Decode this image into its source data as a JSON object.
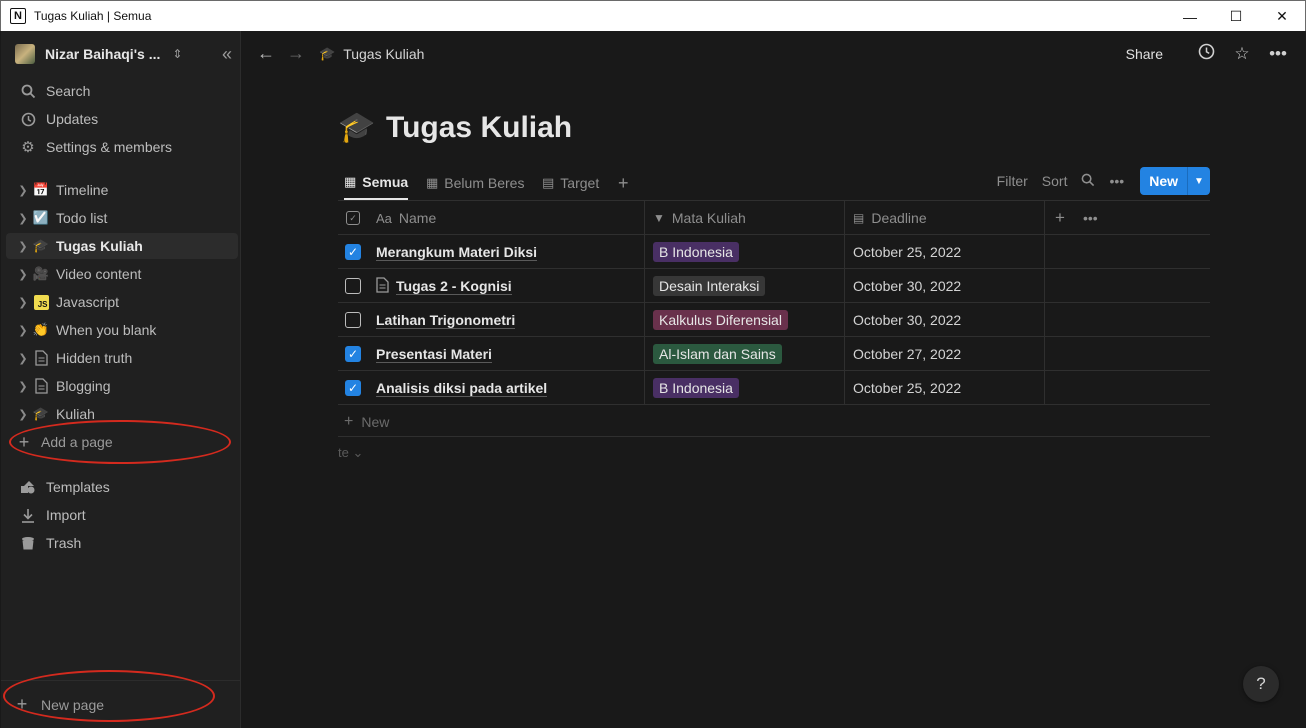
{
  "window": {
    "title": "Tugas Kuliah | Semua",
    "app_icon": "N"
  },
  "sidebar": {
    "workspace": "Nizar Baihaqi's ...",
    "nav": [
      {
        "label": "Search",
        "icon": "search-icon"
      },
      {
        "label": "Updates",
        "icon": "clock-icon"
      },
      {
        "label": "Settings & members",
        "icon": "gear-icon"
      }
    ],
    "pages": [
      {
        "label": "Timeline",
        "emoji": "📅"
      },
      {
        "label": "Todo list",
        "emoji": "☑️"
      },
      {
        "label": "Tugas Kuliah",
        "emoji": "🎓"
      },
      {
        "label": "Video content",
        "emoji": "🎥"
      },
      {
        "label": "Javascript",
        "emoji": "JS"
      },
      {
        "label": "When you blank",
        "emoji": "👏"
      },
      {
        "label": "Hidden truth",
        "emoji": "📄"
      },
      {
        "label": "Blogging",
        "emoji": "📄"
      },
      {
        "label": "Kuliah",
        "emoji": "🎓"
      }
    ],
    "add_page": "Add a page",
    "footer_nav": [
      {
        "label": "Templates",
        "icon": "shapes-icon"
      },
      {
        "label": "Import",
        "icon": "download-icon"
      },
      {
        "label": "Trash",
        "icon": "trash-icon"
      }
    ],
    "new_page": "New page"
  },
  "topbar": {
    "breadcrumb": "Tugas Kuliah",
    "share": "Share"
  },
  "page": {
    "emoji": "🎓",
    "title": "Tugas Kuliah",
    "views": [
      {
        "label": "Semua"
      },
      {
        "label": "Belum Beres"
      },
      {
        "label": "Target"
      }
    ],
    "tools": {
      "filter": "Filter",
      "sort": "Sort",
      "new": "New"
    },
    "columns": {
      "name": "Name",
      "mata_kuliah": "Mata Kuliah",
      "deadline": "Deadline",
      "name_prefix": "Aa"
    },
    "rows": [
      {
        "done": true,
        "name": "Merangkum Materi Diksi",
        "mata_kuliah": "B Indonesia",
        "deadline": "October 25, 2022",
        "has_doc": false
      },
      {
        "done": false,
        "name": "Tugas 2 - Kognisi",
        "mata_kuliah": "Desain Interaksi",
        "deadline": "October 30, 2022",
        "has_doc": true
      },
      {
        "done": false,
        "name": "Latihan Trigonometri",
        "mata_kuliah": "Kalkulus Diferensial",
        "deadline": "October 30, 2022",
        "has_doc": false
      },
      {
        "done": true,
        "name": "Presentasi Materi",
        "mata_kuliah": "Al-Islam dan Sains",
        "deadline": "October 27, 2022",
        "has_doc": false
      },
      {
        "done": true,
        "name": "Analisis diksi pada artikel",
        "mata_kuliah": "B Indonesia",
        "deadline": "October 25, 2022",
        "has_doc": false
      }
    ],
    "tag_colors": {
      "B Indonesia": "#492f64",
      "Desain Interaksi": "#373737",
      "Kalkulus Diferensial": "#69314c",
      "Al-Islam dan Sains": "#2b593f"
    },
    "add_row": "New",
    "calc": "te"
  },
  "help": "?"
}
